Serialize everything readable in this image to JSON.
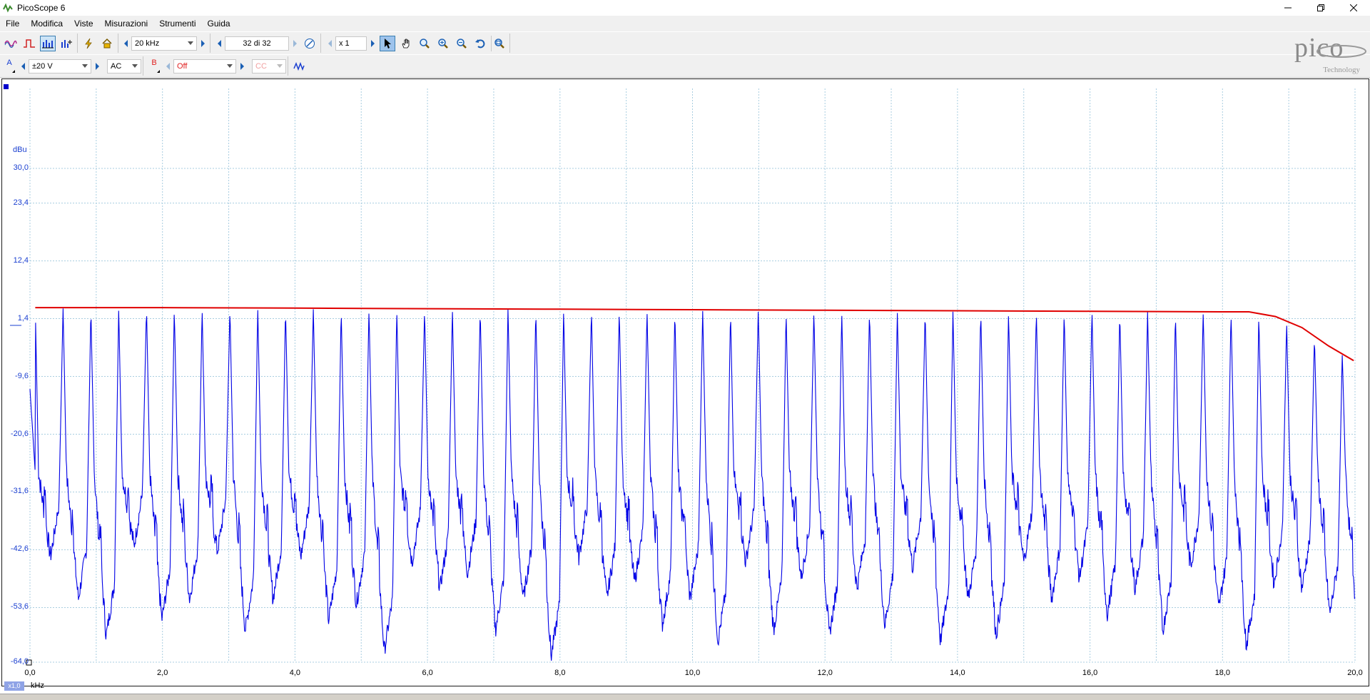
{
  "window": {
    "title": "PicoScope 6"
  },
  "menu": [
    "File",
    "Modifica",
    "Viste",
    "Misurazioni",
    "Strumenti",
    "Guida"
  ],
  "toolbar": {
    "timebase": "20 kHz",
    "buffer": "32 di 32",
    "zoom": "x 1"
  },
  "channel_a": {
    "label": "A",
    "range": "±20 V",
    "coupling": "AC"
  },
  "channel_b": {
    "label": "B",
    "range": "Off",
    "coupling": "CC"
  },
  "logo": {
    "text": "pico",
    "sub": "Technology"
  },
  "colors": {
    "trace": "#0000e6",
    "envelope": "#e00000",
    "grid": "#a8cde0",
    "axis_text": "#1a3fd0"
  },
  "chart_data": {
    "type": "line",
    "xlabel": "kHz",
    "ylabel": "dBu",
    "xlim": [
      0,
      20
    ],
    "ylim": [
      -64.0,
      30.0
    ],
    "x_ticks": [
      "0,0",
      "2,0",
      "4,0",
      "6,0",
      "8,0",
      "10,0",
      "12,0",
      "14,0",
      "16,0",
      "18,0",
      "20,0"
    ],
    "y_ticks": [
      "30,0",
      "23,4",
      "12,4",
      "1,4",
      "-9,6",
      "-20,6",
      "-31,6",
      "-42,6",
      "-53,6",
      "-64,0"
    ],
    "zoom_badge": "x1,0",
    "series": [
      {
        "kind": "spectrum",
        "color": "#0000e6",
        "peak_count": 48,
        "peak_level": 3.5,
        "trough_levels": [
          -44,
          -52,
          -59,
          -42,
          -56,
          -52,
          -43,
          -58,
          -52,
          -44,
          -56,
          -53,
          -62,
          -45,
          -50,
          -47,
          -58,
          -52,
          -63,
          -44,
          -52,
          -49,
          -57,
          -52,
          -60,
          -45,
          -58,
          -48,
          -59,
          -50,
          -57,
          -46,
          -60,
          -52,
          -59,
          -45,
          -52,
          -48,
          -55,
          -50,
          -58,
          -46,
          -54,
          -61,
          -49,
          -50,
          -55,
          -60
        ]
      },
      {
        "kind": "envelope",
        "color": "#e00000",
        "x": [
          0.08,
          2.0,
          4.0,
          6.0,
          8.0,
          10.0,
          12.0,
          14.0,
          16.0,
          18.0,
          18.4,
          18.8,
          19.2,
          19.6,
          19.98
        ],
        "y": [
          3.5,
          3.5,
          3.4,
          3.3,
          3.2,
          3.1,
          3.0,
          2.9,
          2.8,
          2.7,
          2.7,
          1.8,
          -0.3,
          -3.8,
          -6.6
        ]
      }
    ]
  }
}
